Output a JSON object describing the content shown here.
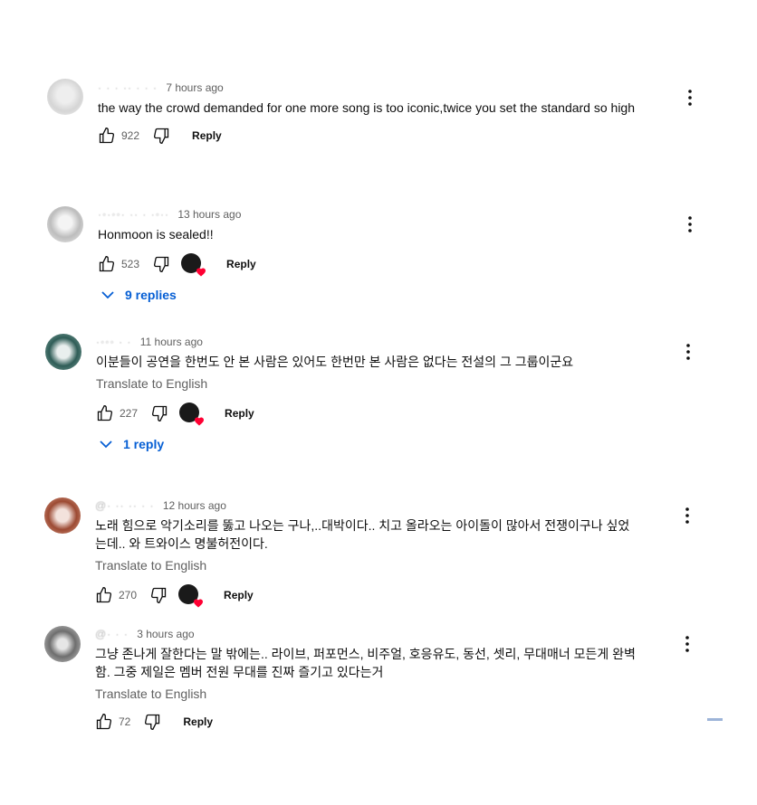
{
  "comments": [
    {
      "author": "",
      "time": "7 hours ago",
      "text": "the way the crowd demanded for one more song is too iconic,twice you set the standard so high",
      "likes": "922",
      "reply_label": "Reply",
      "avatar_color": "#d9d9d9"
    },
    {
      "author": "",
      "time": "13 hours ago",
      "text": "Honmoon is sealed!!",
      "likes": "523",
      "reply_label": "Reply",
      "replies_label": "9 replies",
      "avatar_color": "#cfcfcf"
    },
    {
      "author": "",
      "time": "11 hours ago",
      "text": "이분들이 공연을 한번도 안 본 사람은 있어도 한번만 본 사람은 없다는 전설의 그 그룹이군요",
      "translate_label": "Translate to English",
      "likes": "227",
      "reply_label": "Reply",
      "replies_label": "1 reply",
      "avatar_color": "#2f5d57"
    },
    {
      "author": "",
      "time": "12 hours ago",
      "text_line1": "노래 힘으로 악기소리를 뚫고 나오는 구나,..대박이다..  치고 올라오는 아이돌이 많아서 전쟁이구나 싶었",
      "text_line2": "는데..  와  트와이스 명불허전이다.",
      "translate_label": "Translate to English",
      "likes": "270",
      "reply_label": "Reply",
      "avatar_color": "#9c4a33"
    },
    {
      "author": "",
      "time": "3 hours ago",
      "text_line1": "그냥 존나게 잘한다는 말 밖에는.. 라이브, 퍼포먼스, 비주얼, 호응유도, 동선, 셋리, 무대매너 모든게 완벽",
      "text_line2": "함. 그중 제일은 멤버 전원 무대를 진짜 즐기고 있다는거",
      "translate_label": "Translate to English",
      "likes": "72",
      "reply_label": "Reply",
      "avatar_color": "#6e6e6e"
    }
  ],
  "colors": {
    "link_blue": "#065fd4",
    "secondary_text": "#606060",
    "heart_red": "#ff0033"
  },
  "icons": [
    "thumb-up-icon",
    "thumb-down-icon",
    "more-vert-icon",
    "chevron-down-icon",
    "heart-icon"
  ]
}
